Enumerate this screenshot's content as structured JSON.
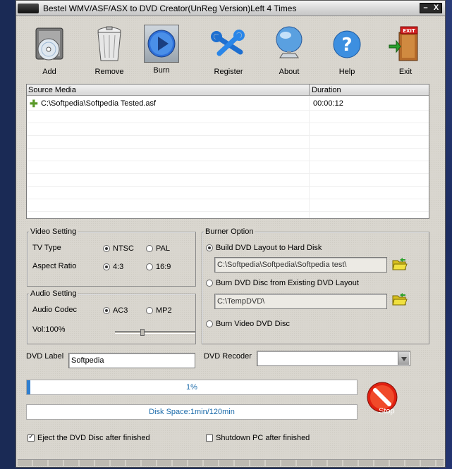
{
  "window": {
    "title": "Bestel WMV/ASF/ASX to DVD Creator(UnReg Version)Left 4 Times",
    "minimize": "–",
    "close": "X"
  },
  "toolbar": {
    "add": "Add",
    "remove": "Remove",
    "burn": "Burn",
    "register": "Register",
    "about": "About",
    "help": "Help",
    "exit": "Exit",
    "exit_sign": "EXIT"
  },
  "media_list": {
    "col_source": "Source Media",
    "col_duration": "Duration",
    "rows": [
      {
        "path": "C:\\Softpedia\\Softpedia Tested.asf",
        "duration": "00:00:12"
      }
    ]
  },
  "video_setting": {
    "title": "Video Setting",
    "tv_type_label": "TV Type",
    "ntsc": "NTSC",
    "pal": "PAL",
    "aspect_label": "Aspect Ratio",
    "ratio_43": "4:3",
    "ratio_169": "16:9"
  },
  "audio_setting": {
    "title": "Audio Setting",
    "codec_label": "Audio Codec",
    "ac3": "AC3",
    "mp2": "MP2",
    "volume_label": "Vol:100%"
  },
  "burner_option": {
    "title": "Burner Option",
    "opt_build": "Build DVD Layout to Hard Disk",
    "build_path": "C:\\Softpedia\\Softpedia\\Softpedia test\\",
    "opt_existing": "Burn DVD Disc from Existing DVD Layout",
    "existing_path": "C:\\TempDVD\\",
    "opt_video": "Burn Video DVD Disc"
  },
  "dvd": {
    "label_caption": "DVD Label",
    "label_value": "Softpedia",
    "recorder_caption": "DVD Recoder",
    "recorder_value": ""
  },
  "progress": {
    "percent_text": "1%",
    "percent": 1,
    "disk_space": "Disk Space:1min/120min",
    "stop": "Stop"
  },
  "options": {
    "eject": "Eject the DVD Disc after finished",
    "shutdown": "Shutdown PC after finished"
  }
}
